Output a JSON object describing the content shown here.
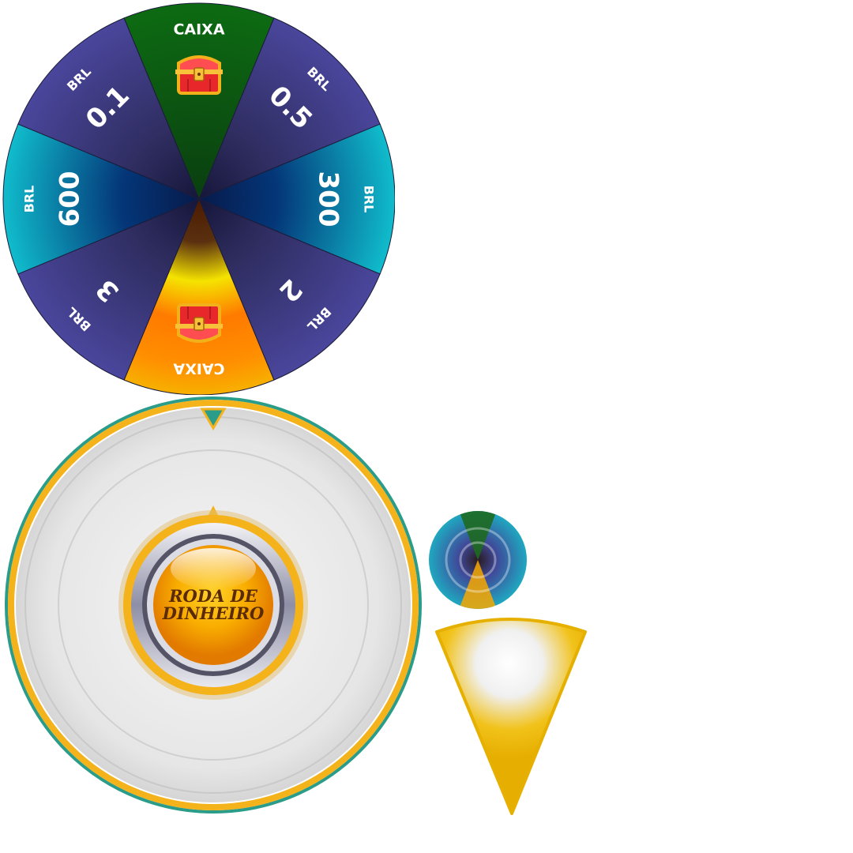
{
  "wheel": {
    "segments": [
      {
        "label": "CAIXA",
        "value": "",
        "icon": "treasure-chest-icon",
        "color": "#0d6b12"
      },
      {
        "label": "BRL",
        "value": "0.5",
        "icon": "",
        "color": "#4a469c"
      },
      {
        "label": "BRL",
        "value": "300",
        "icon": "",
        "color": "#0fb3c8"
      },
      {
        "label": "BRL",
        "value": "2",
        "icon": "",
        "color": "#4a469c"
      },
      {
        "label": "CAIXA",
        "value": "",
        "icon": "treasure-chest-icon",
        "color": "#f7a800"
      },
      {
        "label": "BRL",
        "value": "3",
        "icon": "",
        "color": "#4a469c"
      },
      {
        "label": "BRL",
        "value": "600",
        "icon": "",
        "color": "#0fb3c8"
      },
      {
        "label": "BRL",
        "value": "0.1",
        "icon": "",
        "color": "#4a469c"
      }
    ]
  },
  "spin_button": {
    "line1": "RODA DE",
    "line2": "DINHEIRO"
  },
  "colors": {
    "frame_gold": "#f4b21b",
    "frame_teal": "#2a9c8a",
    "button_orange": "#f7a300"
  }
}
